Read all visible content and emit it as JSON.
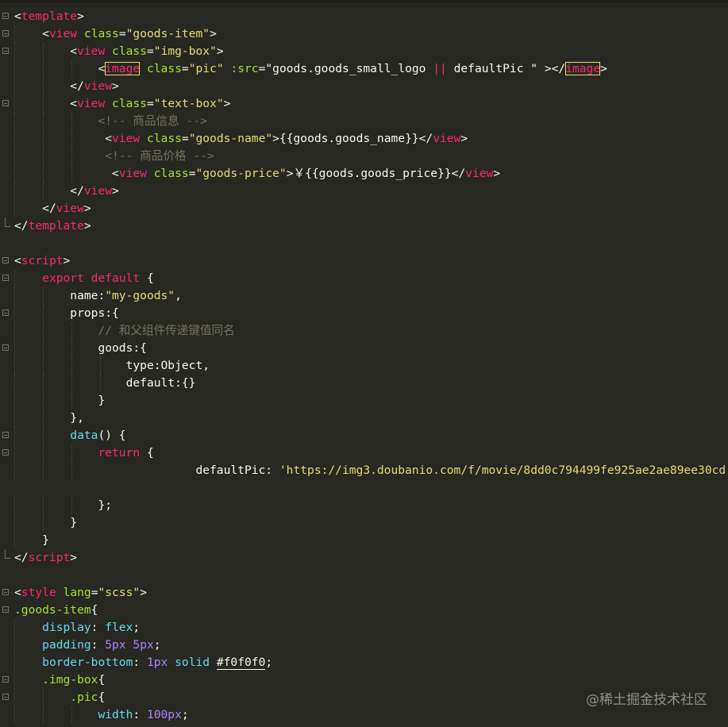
{
  "editor": {
    "theme_colors": {
      "background": "#272822",
      "tag": "#f92672",
      "attribute": "#a6e22e",
      "string": "#e6db74",
      "comment": "#75715e",
      "number": "#ae81ff"
    },
    "lines": [
      {
        "indent": 0,
        "fold": "open",
        "tokens": [
          {
            "c": "t",
            "v": "<"
          },
          {
            "c": "tg",
            "v": "template"
          },
          {
            "c": "t",
            "v": ">"
          }
        ]
      },
      {
        "indent": 1,
        "fold": "open",
        "tokens": [
          {
            "c": "t",
            "v": "<"
          },
          {
            "c": "tg",
            "v": "view"
          },
          {
            "c": "t",
            "v": " "
          },
          {
            "c": "at",
            "v": "class"
          },
          {
            "c": "t",
            "v": "="
          },
          {
            "c": "st",
            "v": "\"goods-item\""
          },
          {
            "c": "t",
            "v": ">"
          }
        ]
      },
      {
        "indent": 2,
        "fold": "open",
        "tokens": [
          {
            "c": "t",
            "v": "<"
          },
          {
            "c": "tg",
            "v": "view"
          },
          {
            "c": "t",
            "v": " "
          },
          {
            "c": "at",
            "v": "class"
          },
          {
            "c": "t",
            "v": "="
          },
          {
            "c": "st",
            "v": "\"img-box\""
          },
          {
            "c": "t",
            "v": ">"
          }
        ]
      },
      {
        "indent": 3,
        "fold": "none",
        "tokens": [
          {
            "c": "t",
            "v": "<"
          },
          {
            "c": "tg bx",
            "v": "image"
          },
          {
            "c": "t",
            "v": " "
          },
          {
            "c": "at",
            "v": "class"
          },
          {
            "c": "t",
            "v": "="
          },
          {
            "c": "st",
            "v": "\"pic\""
          },
          {
            "c": "t",
            "v": " "
          },
          {
            "c": "at",
            "v": ":src"
          },
          {
            "c": "t",
            "v": "=\"goods.goods_small_logo "
          },
          {
            "c": "kw",
            "v": "||"
          },
          {
            "c": "t",
            "v": " defaultPic \" ></"
          },
          {
            "c": "tg bx",
            "v": "image"
          },
          {
            "c": "t",
            "v": ">"
          }
        ]
      },
      {
        "indent": 2,
        "fold": "none",
        "tokens": [
          {
            "c": "t",
            "v": "</"
          },
          {
            "c": "tg",
            "v": "view"
          },
          {
            "c": "t",
            "v": ">"
          }
        ]
      },
      {
        "indent": 2,
        "fold": "open",
        "tokens": [
          {
            "c": "t",
            "v": "<"
          },
          {
            "c": "tg",
            "v": "view"
          },
          {
            "c": "t",
            "v": " "
          },
          {
            "c": "at",
            "v": "class"
          },
          {
            "c": "t",
            "v": "="
          },
          {
            "c": "st",
            "v": "\"text-box\""
          },
          {
            "c": "t",
            "v": ">"
          }
        ]
      },
      {
        "indent": 3,
        "fold": "none",
        "tokens": [
          {
            "c": "cm",
            "v": "<!-- 商品信息 -->"
          }
        ]
      },
      {
        "indent": 3,
        "fold": "none",
        "tokens": [
          {
            "c": "t",
            "v": " <"
          },
          {
            "c": "tg",
            "v": "view"
          },
          {
            "c": "t",
            "v": " "
          },
          {
            "c": "at",
            "v": "class"
          },
          {
            "c": "t",
            "v": "="
          },
          {
            "c": "st",
            "v": "\"goods-name\""
          },
          {
            "c": "t",
            "v": ">{{goods.goods_name}}</"
          },
          {
            "c": "tg",
            "v": "view"
          },
          {
            "c": "t",
            "v": ">"
          }
        ]
      },
      {
        "indent": 3,
        "fold": "none",
        "tokens": [
          {
            "c": "cm",
            "v": " <!-- 商品价格 -->"
          }
        ]
      },
      {
        "indent": 3,
        "fold": "none",
        "tokens": [
          {
            "c": "t",
            "v": "  <"
          },
          {
            "c": "tg",
            "v": "view"
          },
          {
            "c": "t",
            "v": " "
          },
          {
            "c": "at",
            "v": "class"
          },
          {
            "c": "t",
            "v": "="
          },
          {
            "c": "st",
            "v": "\"goods-price\""
          },
          {
            "c": "t",
            "v": ">￥{{goods.goods_price}}</"
          },
          {
            "c": "tg",
            "v": "view"
          },
          {
            "c": "t",
            "v": ">"
          }
        ]
      },
      {
        "indent": 2,
        "fold": "none",
        "tokens": [
          {
            "c": "t",
            "v": "</"
          },
          {
            "c": "tg",
            "v": "view"
          },
          {
            "c": "t",
            "v": ">"
          }
        ]
      },
      {
        "indent": 1,
        "fold": "none",
        "tokens": [
          {
            "c": "t",
            "v": "</"
          },
          {
            "c": "tg",
            "v": "view"
          },
          {
            "c": "t",
            "v": ">"
          }
        ]
      },
      {
        "indent": 0,
        "fold": "end",
        "tokens": [
          {
            "c": "t",
            "v": "</"
          },
          {
            "c": "tg",
            "v": "template"
          },
          {
            "c": "t",
            "v": ">"
          }
        ]
      },
      {
        "indent": 0,
        "fold": "none",
        "tokens": []
      },
      {
        "indent": 0,
        "fold": "open",
        "tokens": [
          {
            "c": "t",
            "v": "<"
          },
          {
            "c": "tg",
            "v": "script"
          },
          {
            "c": "t",
            "v": ">"
          }
        ]
      },
      {
        "indent": 1,
        "fold": "open",
        "tokens": [
          {
            "c": "kw",
            "v": "export"
          },
          {
            "c": "t",
            "v": " "
          },
          {
            "c": "kw",
            "v": "default"
          },
          {
            "c": "t",
            "v": " {"
          }
        ]
      },
      {
        "indent": 2,
        "fold": "none",
        "tokens": [
          {
            "c": "t",
            "v": "name:"
          },
          {
            "c": "st",
            "v": "\"my-goods\""
          },
          {
            "c": "t",
            "v": ","
          }
        ]
      },
      {
        "indent": 2,
        "fold": "open",
        "tokens": [
          {
            "c": "t",
            "v": "props:{"
          }
        ]
      },
      {
        "indent": 3,
        "fold": "none",
        "tokens": [
          {
            "c": "cm",
            "v": "// 和父组件传递键值同名"
          }
        ]
      },
      {
        "indent": 3,
        "fold": "open",
        "tokens": [
          {
            "c": "t",
            "v": "goods:{"
          }
        ]
      },
      {
        "indent": 4,
        "fold": "none",
        "tokens": [
          {
            "c": "t",
            "v": "type:Object,"
          }
        ]
      },
      {
        "indent": 4,
        "fold": "none",
        "tokens": [
          {
            "c": "t",
            "v": "default:{}"
          }
        ]
      },
      {
        "indent": 3,
        "fold": "none",
        "tokens": [
          {
            "c": "t",
            "v": "}"
          }
        ]
      },
      {
        "indent": 2,
        "fold": "none",
        "tokens": [
          {
            "c": "t",
            "v": "},"
          }
        ]
      },
      {
        "indent": 2,
        "fold": "open",
        "tokens": [
          {
            "c": "fn",
            "v": "data"
          },
          {
            "c": "t",
            "v": "() {"
          }
        ]
      },
      {
        "indent": 3,
        "fold": "open",
        "tokens": [
          {
            "c": "kw",
            "v": "return"
          },
          {
            "c": "t",
            "v": " {"
          }
        ]
      },
      {
        "indent": 3,
        "fold": "none",
        "tokens": [
          {
            "c": "t",
            "v": "              defaultPic: "
          },
          {
            "c": "st",
            "v": "'https://img3.doubanio.com/f/movie/8dd0c794499fe925ae2ae89ee30cd"
          }
        ]
      },
      {
        "indent": 0,
        "fold": "none",
        "tokens": []
      },
      {
        "indent": 3,
        "fold": "none",
        "tokens": [
          {
            "c": "t",
            "v": "};"
          }
        ]
      },
      {
        "indent": 2,
        "fold": "none",
        "tokens": [
          {
            "c": "t",
            "v": "}"
          }
        ]
      },
      {
        "indent": 1,
        "fold": "none",
        "tokens": [
          {
            "c": "t",
            "v": "}"
          }
        ]
      },
      {
        "indent": 0,
        "fold": "end",
        "tokens": [
          {
            "c": "t",
            "v": "</"
          },
          {
            "c": "tg",
            "v": "script"
          },
          {
            "c": "t",
            "v": ">"
          }
        ]
      },
      {
        "indent": 0,
        "fold": "none",
        "tokens": []
      },
      {
        "indent": 0,
        "fold": "open",
        "tokens": [
          {
            "c": "t",
            "v": "<"
          },
          {
            "c": "tg",
            "v": "style"
          },
          {
            "c": "t",
            "v": " "
          },
          {
            "c": "at",
            "v": "lang"
          },
          {
            "c": "t",
            "v": "="
          },
          {
            "c": "st",
            "v": "\"scss\""
          },
          {
            "c": "t",
            "v": ">"
          }
        ]
      },
      {
        "indent": 0,
        "fold": "open",
        "tokens": [
          {
            "c": "at",
            "v": ".goods-item"
          },
          {
            "c": "t",
            "v": "{"
          }
        ]
      },
      {
        "indent": 1,
        "fold": "none",
        "tokens": [
          {
            "c": "fn",
            "v": "display"
          },
          {
            "c": "t",
            "v": ": "
          },
          {
            "c": "fn",
            "v": "flex"
          },
          {
            "c": "t",
            "v": ";"
          }
        ]
      },
      {
        "indent": 1,
        "fold": "none",
        "tokens": [
          {
            "c": "fn",
            "v": "padding"
          },
          {
            "c": "t",
            "v": ": "
          },
          {
            "c": "nm",
            "v": "5px"
          },
          {
            "c": "t",
            "v": " "
          },
          {
            "c": "nm",
            "v": "5px"
          },
          {
            "c": "t",
            "v": ";"
          }
        ]
      },
      {
        "indent": 1,
        "fold": "none",
        "tokens": [
          {
            "c": "fn",
            "v": "border-bottom"
          },
          {
            "c": "t",
            "v": ": "
          },
          {
            "c": "nm",
            "v": "1px"
          },
          {
            "c": "t",
            "v": " "
          },
          {
            "c": "fn",
            "v": "solid"
          },
          {
            "c": "t",
            "v": " "
          },
          {
            "c": "t ul",
            "v": "#f0f0f0"
          },
          {
            "c": "t",
            "v": ";"
          }
        ]
      },
      {
        "indent": 1,
        "fold": "open",
        "tokens": [
          {
            "c": "at",
            "v": ".img-box"
          },
          {
            "c": "t",
            "v": "{"
          }
        ]
      },
      {
        "indent": 2,
        "fold": "open",
        "tokens": [
          {
            "c": "at",
            "v": ".pic"
          },
          {
            "c": "t",
            "v": "{"
          }
        ]
      },
      {
        "indent": 3,
        "fold": "none",
        "tokens": [
          {
            "c": "fn",
            "v": "width"
          },
          {
            "c": "t",
            "v": ": "
          },
          {
            "c": "nm",
            "v": "100px"
          },
          {
            "c": "t",
            "v": ";"
          }
        ]
      }
    ]
  },
  "watermark": "@稀土掘金技术社区"
}
